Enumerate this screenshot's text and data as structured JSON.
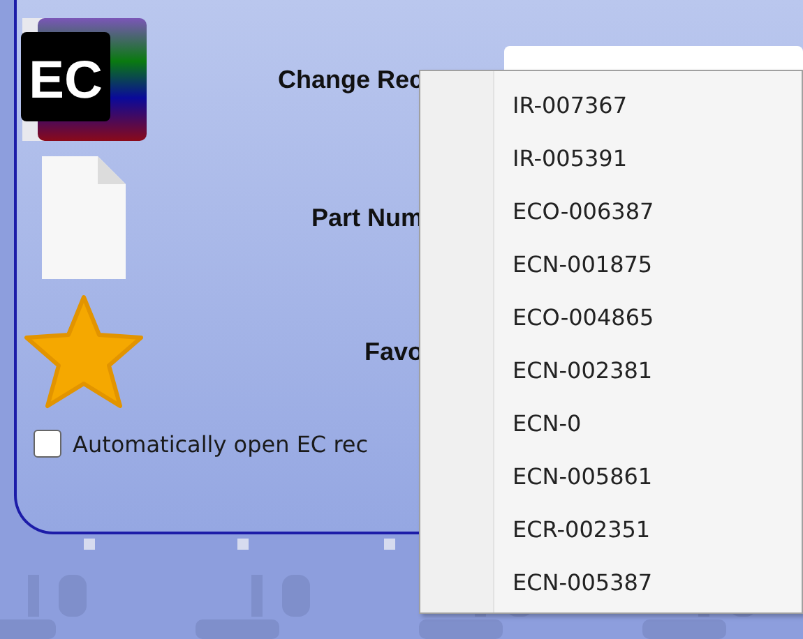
{
  "form": {
    "fields": [
      {
        "kind": "record",
        "label": "Change Rec",
        "icon_text": "EC"
      },
      {
        "kind": "part",
        "label": "Part Num"
      },
      {
        "kind": "favorite",
        "label": "Favo"
      }
    ],
    "auto_open": {
      "label": "Automatically open EC rec",
      "checked": false
    }
  },
  "dropdown": {
    "items": [
      {
        "label": "IR-007367"
      },
      {
        "label": "IR-005391"
      },
      {
        "label": "ECO-006387"
      },
      {
        "label": "ECN-001875"
      },
      {
        "label": "ECO-004865"
      },
      {
        "label": "ECN-002381"
      },
      {
        "label": "ECN-0"
      },
      {
        "label": "ECN-005861"
      },
      {
        "label": "ECR-002351"
      },
      {
        "label": "ECN-005387"
      }
    ]
  }
}
